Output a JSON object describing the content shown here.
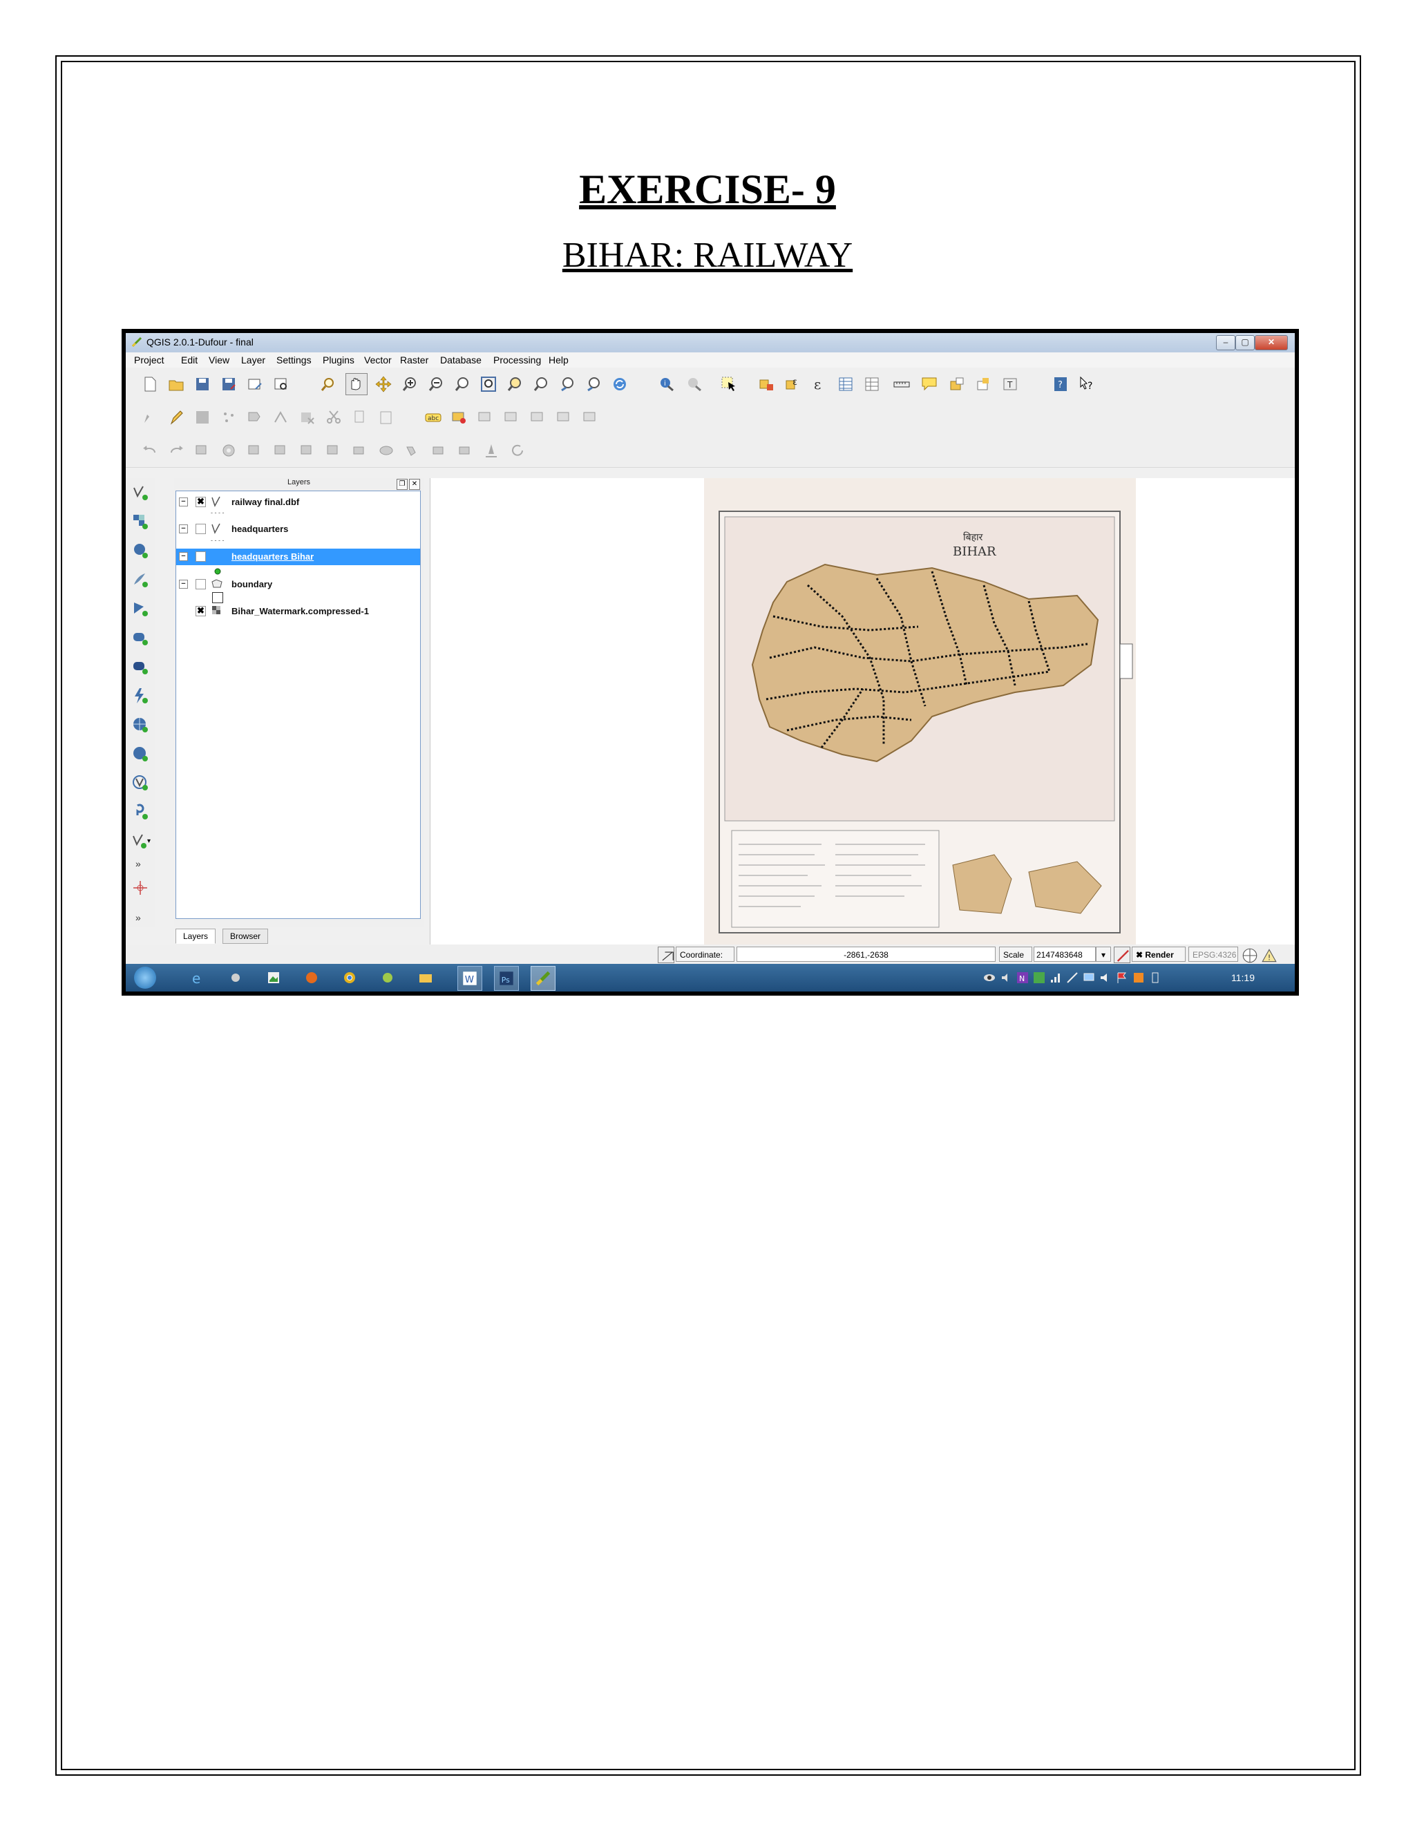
{
  "page": {
    "title": "EXERCISE- 9",
    "subtitle": "BIHAR: RAILWAY"
  },
  "app": {
    "window_title": "QGIS 2.0.1-Dufour - final",
    "menu": [
      "Project",
      "Edit",
      "View",
      "Layer",
      "Settings",
      "Plugins",
      "Vector",
      "Raster",
      "Database",
      "Processing",
      "Help"
    ]
  },
  "layers_panel": {
    "title": "Layers",
    "layers": [
      {
        "label": "railway final.dbf",
        "checked": true,
        "icon": "line-vector-icon"
      },
      {
        "label": "headquarters",
        "checked": false,
        "icon": "line-vector-icon"
      },
      {
        "label": "headquarters Bihar",
        "checked": false,
        "icon": "point-vector-icon",
        "selected": true
      },
      {
        "label": "boundary",
        "checked": false,
        "icon": "polygon-vector-icon"
      },
      {
        "label": "Bihar_Watermark.compressed-1",
        "checked": true,
        "icon": "raster-icon"
      }
    ],
    "tabs": [
      "Layers",
      "Browser"
    ]
  },
  "map": {
    "title_hindi": "बिहार",
    "title": "BIHAR"
  },
  "statusbar": {
    "coordinate_label": "Coordinate:",
    "coordinate_value": "-2861,-2638",
    "scale_label": "Scale",
    "scale_value": "2147483648",
    "render_label": "Render",
    "crs": "EPSG:4326"
  },
  "taskbar": {
    "clock": "11:19"
  },
  "colors": {
    "selection": "#3399ff",
    "map_fill": "#d9b98a",
    "taskbar": "#24568a"
  }
}
